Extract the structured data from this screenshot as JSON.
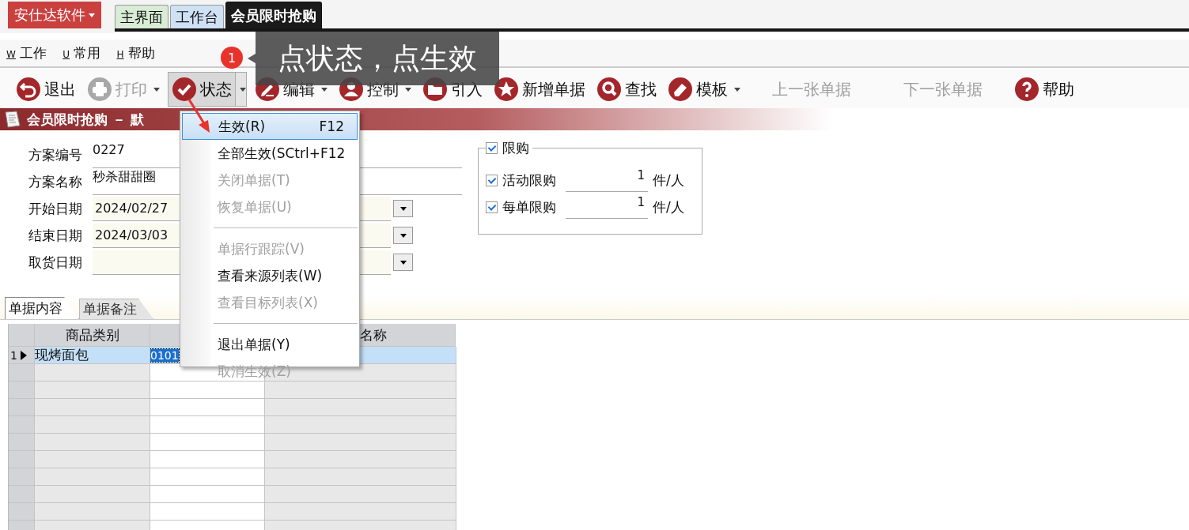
{
  "brand": {
    "label": "安仕达软件"
  },
  "doc_tabs": [
    {
      "label": "主界面",
      "selected": false,
      "color": "#d8ecd6"
    },
    {
      "label": "工作台",
      "selected": false,
      "color": "#cfe1f5"
    },
    {
      "label": "会员限时抢购",
      "selected": true,
      "color": "#1a1a1a"
    }
  ],
  "menu_bar": [
    {
      "key": "W",
      "label": "工作"
    },
    {
      "key": "U",
      "label": "常用"
    },
    {
      "key": "H",
      "label": "帮助"
    }
  ],
  "toolbar": [
    {
      "label": "退出",
      "disabled": false,
      "dropdown": false,
      "pressed": false
    },
    {
      "label": "打印",
      "disabled": true,
      "dropdown": true,
      "pressed": false
    },
    {
      "label": "状态",
      "disabled": false,
      "dropdown": true,
      "pressed": true
    },
    {
      "label": "编辑",
      "disabled": false,
      "dropdown": true,
      "pressed": false
    },
    {
      "label": "控制",
      "disabled": false,
      "dropdown": true,
      "pressed": false
    },
    {
      "label": "引入",
      "disabled": false,
      "dropdown": false,
      "pressed": false
    },
    {
      "label": "新增单据",
      "disabled": false,
      "dropdown": false,
      "pressed": false
    },
    {
      "label": "查找",
      "disabled": false,
      "dropdown": false,
      "pressed": false
    },
    {
      "label": "模板",
      "disabled": false,
      "dropdown": true,
      "pressed": false
    },
    {
      "label": "上一张单据",
      "disabled": true,
      "dropdown": false,
      "pressed": false
    },
    {
      "label": "下一张单据",
      "disabled": true,
      "dropdown": false,
      "pressed": false
    },
    {
      "label": "帮助",
      "disabled": false,
      "dropdown": false,
      "pressed": false
    }
  ],
  "callout": {
    "step": "1",
    "text": "点状态，点生效"
  },
  "form_title": "会员限时抢购 － 默",
  "fields": [
    {
      "kind": "text",
      "label": "方案编号",
      "value": "0227"
    },
    {
      "kind": "text",
      "label": "方案名称",
      "value": "秒杀甜甜圈"
    },
    {
      "kind": "date",
      "label": "开始日期",
      "value": "2024/02/27"
    },
    {
      "kind": "date",
      "label": "结束日期",
      "value": "2024/03/03"
    },
    {
      "kind": "date",
      "label": "取货日期"
    }
  ],
  "limit_group": {
    "label": "限购",
    "checked": true,
    "rows": [
      {
        "label": "活动限购",
        "checked": true,
        "value": "1",
        "unit": "件/人"
      },
      {
        "label": "每单限购",
        "checked": true,
        "value": "1",
        "unit": "件/人"
      }
    ]
  },
  "detail_tabs": [
    {
      "label": "单据内容",
      "selected": true
    },
    {
      "label": "单据备注",
      "selected": false
    }
  ],
  "table": {
    "columns": [
      {
        "label": "商品类别"
      },
      {},
      {
        "label": "名称"
      }
    ],
    "rows": [
      {
        "number": "1",
        "current": true,
        "cells": [
          "现烤面包",
          "0101",
          null
        ]
      }
    ]
  },
  "status_menu": [
    {
      "kind": "item",
      "label": "生效(R)",
      "shortcut": "F12",
      "disabled": false,
      "selected": true
    },
    {
      "kind": "item",
      "label": "全部生效(S",
      "shortcut": "Ctrl+F12",
      "disabled": false,
      "selected": false
    },
    {
      "kind": "item",
      "label": "关闭单据(T)",
      "disabled": true,
      "selected": false
    },
    {
      "kind": "item",
      "label": "恢复单据(U)",
      "disabled": true,
      "selected": false
    },
    {
      "kind": "separator"
    },
    {
      "kind": "item",
      "label": "单据行跟踪(V)",
      "disabled": true,
      "selected": false
    },
    {
      "kind": "item",
      "label": "查看来源列表(W)",
      "disabled": false,
      "selected": false
    },
    {
      "kind": "item",
      "label": "查看目标列表(X)",
      "disabled": true,
      "selected": false
    },
    {
      "kind": "separator"
    },
    {
      "kind": "item",
      "label": "退出单据(Y)",
      "disabled": false,
      "selected": false
    },
    {
      "kind": "item",
      "label": "取消生效(Z)",
      "disabled": true,
      "selected": false
    }
  ]
}
